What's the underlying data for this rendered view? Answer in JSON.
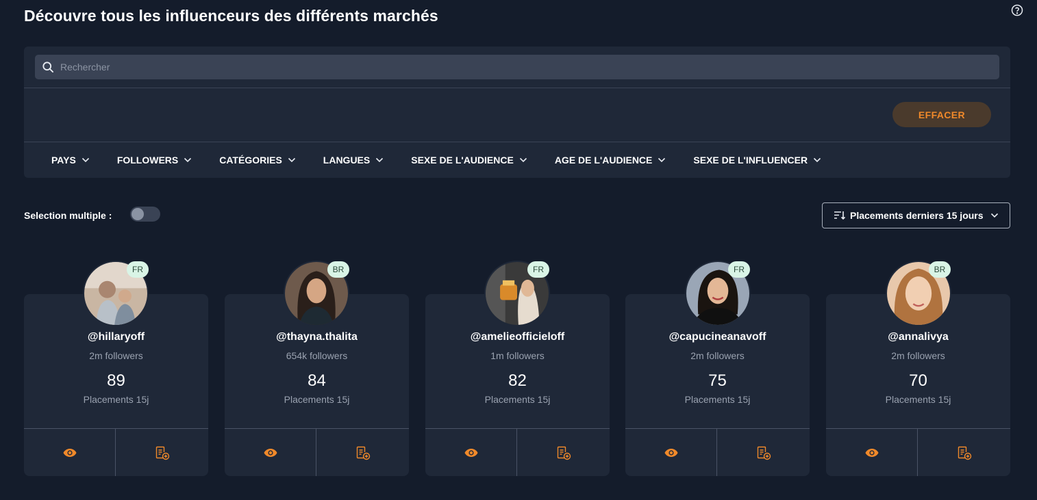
{
  "header": {
    "title": "Découvre tous les influenceurs des différents marchés"
  },
  "search": {
    "placeholder": "Rechercher",
    "value": ""
  },
  "filters": {
    "clear_label": "EFFACER",
    "items": [
      {
        "label": "PAYS"
      },
      {
        "label": "FOLLOWERS"
      },
      {
        "label": "CATÉGORIES"
      },
      {
        "label": "LANGUES"
      },
      {
        "label": "SEXE DE L'AUDIENCE"
      },
      {
        "label": "AGE DE L'AUDIENCE"
      },
      {
        "label": "SEXE DE L'INFLUENCER"
      }
    ]
  },
  "selection": {
    "label": "Selection multiple :",
    "enabled": false
  },
  "sort": {
    "label": "Placements derniers 15 jours"
  },
  "cards": [
    {
      "handle": "@hillaryoff",
      "followers": "2m followers",
      "placements": "89",
      "placements_label": "Placements 15j",
      "country": "FR"
    },
    {
      "handle": "@thayna.thalita",
      "followers": "654k followers",
      "placements": "84",
      "placements_label": "Placements 15j",
      "country": "BR"
    },
    {
      "handle": "@amelieofficieloff",
      "followers": "1m followers",
      "placements": "82",
      "placements_label": "Placements 15j",
      "country": "FR"
    },
    {
      "handle": "@capucineanavoff",
      "followers": "2m followers",
      "placements": "75",
      "placements_label": "Placements 15j",
      "country": "FR"
    },
    {
      "handle": "@annalivya",
      "followers": "2m followers",
      "placements": "70",
      "placements_label": "Placements 15j",
      "country": "BR"
    }
  ],
  "colors": {
    "background": "#141c2b",
    "panel": "#1f2838",
    "accent": "#f0892a",
    "badge": "#d9f4e6"
  },
  "icons": {
    "help": "help-circle-icon",
    "search": "search-icon",
    "chevron": "chevron-down-icon",
    "sort": "sort-icon",
    "view": "eye-icon",
    "add_to_list": "list-add-icon"
  }
}
